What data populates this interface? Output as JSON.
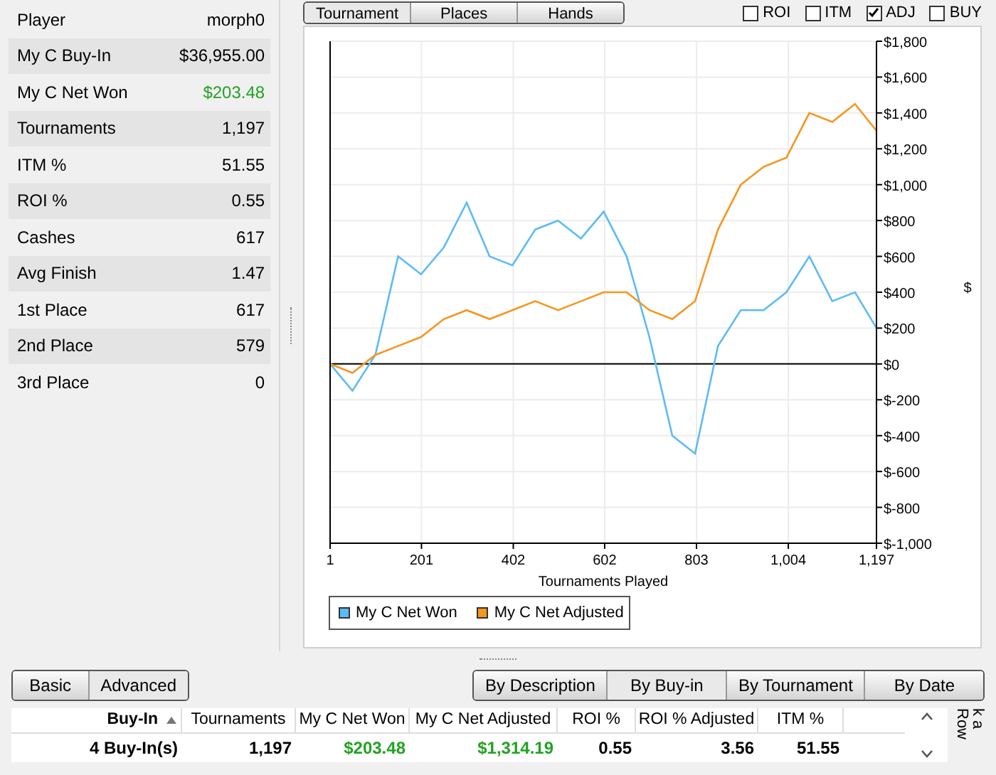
{
  "stats_panel": {
    "rows": [
      {
        "label": "Player",
        "value": "morph0",
        "positive": false
      },
      {
        "label": "My C Buy-In",
        "value": "$36,955.00",
        "positive": false
      },
      {
        "label": "My C Net Won",
        "value": "$203.48",
        "positive": true
      },
      {
        "label": "Tournaments",
        "value": "1,197",
        "positive": false
      },
      {
        "label": "ITM %",
        "value": "51.55",
        "positive": false
      },
      {
        "label": "ROI %",
        "value": "0.55",
        "positive": false
      },
      {
        "label": "Cashes",
        "value": "617",
        "positive": false
      },
      {
        "label": "Avg Finish",
        "value": "1.47",
        "positive": false
      },
      {
        "label": "1st Place",
        "value": "617",
        "positive": false
      },
      {
        "label": "2nd Place",
        "value": "579",
        "positive": false
      },
      {
        "label": "3rd Place",
        "value": "0",
        "positive": false
      }
    ]
  },
  "graph_tabs": [
    {
      "label": "Tournament",
      "selected": true
    },
    {
      "label": "Places",
      "selected": false
    },
    {
      "label": "Hands",
      "selected": false
    }
  ],
  "graph_options": [
    {
      "label": "ROI",
      "checked": false
    },
    {
      "label": "ITM",
      "checked": false
    },
    {
      "label": "ADJ",
      "checked": true
    },
    {
      "label": "BUY",
      "checked": false
    }
  ],
  "graph": {
    "chart_data": {
      "type": "line",
      "grid": true,
      "xlabel": "Tournaments Played",
      "ylabel": "$",
      "x": [
        1,
        50,
        100,
        150,
        200,
        250,
        300,
        350,
        400,
        450,
        500,
        550,
        600,
        650,
        700,
        750,
        800,
        850,
        900,
        950,
        1000,
        1050,
        1100,
        1150,
        1197
      ],
      "series": [
        {
          "name": "My C Net Won",
          "color": "#5bbcf5",
          "values": [
            0,
            -150,
            50,
            600,
            500,
            650,
            900,
            600,
            550,
            750,
            800,
            700,
            850,
            600,
            150,
            -400,
            -500,
            100,
            300,
            300,
            400,
            600,
            350,
            400,
            200
          ]
        },
        {
          "name": "My C Net Adjusted",
          "color": "#f5961e",
          "values": [
            0,
            -50,
            50,
            100,
            150,
            250,
            300,
            250,
            300,
            350,
            300,
            350,
            400,
            400,
            300,
            250,
            350,
            750,
            1000,
            1100,
            1150,
            1400,
            1350,
            1450,
            1300
          ]
        }
      ],
      "xlim": [
        1,
        1197
      ],
      "ylim": [
        -1000,
        1800
      ],
      "xticks": [
        1,
        201,
        402,
        602,
        803,
        {
          "value": 1004,
          "label": "1,004"
        },
        {
          "value": 1197,
          "label": "1,197"
        }
      ],
      "yticks": [
        {
          "value": -1000,
          "label": "$-1,000"
        },
        {
          "value": -800,
          "label": "$-800"
        },
        {
          "value": -600,
          "label": "$-600"
        },
        {
          "value": -400,
          "label": "$-400"
        },
        {
          "value": -200,
          "label": "$-200"
        },
        {
          "value": 0,
          "label": "$0"
        },
        {
          "value": 200,
          "label": "$200"
        },
        {
          "value": 400,
          "label": "$400"
        },
        {
          "value": 600,
          "label": "$600"
        },
        {
          "value": 800,
          "label": "$800"
        },
        {
          "value": 1000,
          "label": "$1,000"
        },
        {
          "value": 1200,
          "label": "$1,200"
        },
        {
          "value": 1400,
          "label": "$1,400"
        },
        {
          "value": 1600,
          "label": "$1,600"
        },
        {
          "value": 1800,
          "label": "$1,800"
        }
      ]
    }
  },
  "view_tabs": [
    {
      "label": "Basic",
      "selected": false
    },
    {
      "label": "Advanced",
      "selected": true
    }
  ],
  "group_tabs": [
    {
      "label": "By Description",
      "selected": false
    },
    {
      "label": "By Buy-in",
      "selected": true
    },
    {
      "label": "By Tournament",
      "selected": false
    },
    {
      "label": "By Date",
      "selected": false
    }
  ],
  "table": {
    "columns": [
      {
        "label": "Buy-In",
        "sorted": true
      },
      {
        "label": "Tournaments",
        "sorted": false
      },
      {
        "label": "My C Net Won",
        "sorted": false
      },
      {
        "label": "My C Net Adjusted",
        "sorted": false
      },
      {
        "label": "ROI %",
        "sorted": false
      },
      {
        "label": "ROI % Adjusted",
        "sorted": false
      },
      {
        "label": "ITM %",
        "sorted": false
      }
    ],
    "rows": [
      {
        "cells": [
          {
            "text": "4 Buy-In(s)",
            "positive": false
          },
          {
            "text": "1,197",
            "positive": false
          },
          {
            "text": "$203.48",
            "positive": true
          },
          {
            "text": "$1,314.19",
            "positive": true
          },
          {
            "text": "0.55",
            "positive": false
          },
          {
            "text": "3.56",
            "positive": false
          },
          {
            "text": "51.55",
            "positive": false
          }
        ]
      }
    ]
  },
  "side_hint": "k a Row"
}
